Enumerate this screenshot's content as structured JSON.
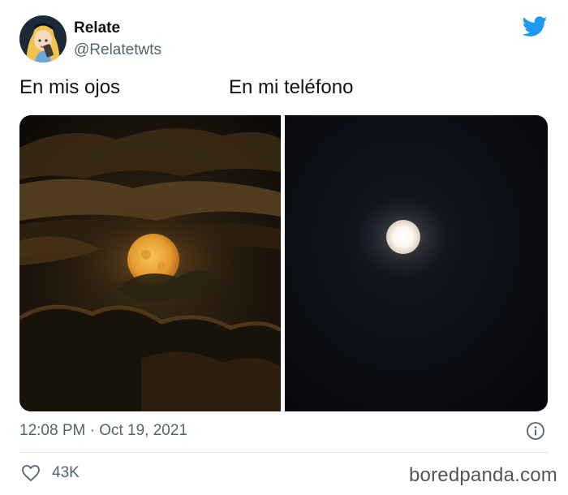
{
  "tweet": {
    "display_name": "Relate",
    "handle": "@Relatetwts",
    "caption_left": "En mis ojos",
    "caption_right": "En mi teléfono",
    "timestamp": "12:08 PM · Oct 19, 2021",
    "likes": "43K"
  },
  "watermark": "boredpanda.com",
  "colors": {
    "twitter_blue": "#1d9bf0",
    "secondary_text": "#536471",
    "divider": "#e1e6ea"
  },
  "icons": {
    "brand": "twitter-bird-icon",
    "info": "info-icon",
    "like": "heart-icon"
  }
}
